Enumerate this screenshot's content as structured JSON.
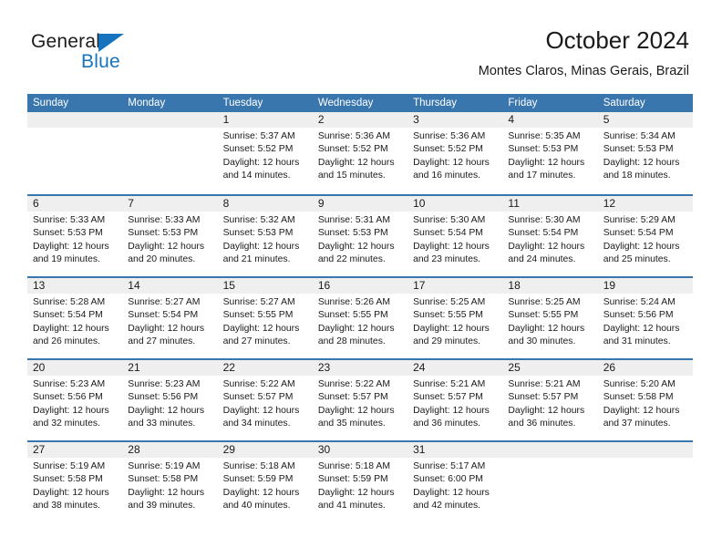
{
  "brand": {
    "name_top": "General",
    "name_bottom": "Blue",
    "accent_color": "#1574bd",
    "triangle_icon": "brand-triangle-icon"
  },
  "header": {
    "title": "October 2024",
    "subtitle": "Montes Claros, Minas Gerais, Brazil"
  },
  "theme": {
    "header_blue": "#3a76ae",
    "daynum_band": "#efefef",
    "text": "#1a1a1a"
  },
  "calendar": {
    "weekday_headers": [
      "Sunday",
      "Monday",
      "Tuesday",
      "Wednesday",
      "Thursday",
      "Friday",
      "Saturday"
    ],
    "weeks": [
      [
        {
          "day": "",
          "lines": []
        },
        {
          "day": "",
          "lines": []
        },
        {
          "day": "1",
          "lines": [
            "Sunrise: 5:37 AM",
            "Sunset: 5:52 PM",
            "Daylight: 12 hours and 14 minutes."
          ]
        },
        {
          "day": "2",
          "lines": [
            "Sunrise: 5:36 AM",
            "Sunset: 5:52 PM",
            "Daylight: 12 hours and 15 minutes."
          ]
        },
        {
          "day": "3",
          "lines": [
            "Sunrise: 5:36 AM",
            "Sunset: 5:52 PM",
            "Daylight: 12 hours and 16 minutes."
          ]
        },
        {
          "day": "4",
          "lines": [
            "Sunrise: 5:35 AM",
            "Sunset: 5:53 PM",
            "Daylight: 12 hours and 17 minutes."
          ]
        },
        {
          "day": "5",
          "lines": [
            "Sunrise: 5:34 AM",
            "Sunset: 5:53 PM",
            "Daylight: 12 hours and 18 minutes."
          ]
        }
      ],
      [
        {
          "day": "6",
          "lines": [
            "Sunrise: 5:33 AM",
            "Sunset: 5:53 PM",
            "Daylight: 12 hours and 19 minutes."
          ]
        },
        {
          "day": "7",
          "lines": [
            "Sunrise: 5:33 AM",
            "Sunset: 5:53 PM",
            "Daylight: 12 hours and 20 minutes."
          ]
        },
        {
          "day": "8",
          "lines": [
            "Sunrise: 5:32 AM",
            "Sunset: 5:53 PM",
            "Daylight: 12 hours and 21 minutes."
          ]
        },
        {
          "day": "9",
          "lines": [
            "Sunrise: 5:31 AM",
            "Sunset: 5:53 PM",
            "Daylight: 12 hours and 22 minutes."
          ]
        },
        {
          "day": "10",
          "lines": [
            "Sunrise: 5:30 AM",
            "Sunset: 5:54 PM",
            "Daylight: 12 hours and 23 minutes."
          ]
        },
        {
          "day": "11",
          "lines": [
            "Sunrise: 5:30 AM",
            "Sunset: 5:54 PM",
            "Daylight: 12 hours and 24 minutes."
          ]
        },
        {
          "day": "12",
          "lines": [
            "Sunrise: 5:29 AM",
            "Sunset: 5:54 PM",
            "Daylight: 12 hours and 25 minutes."
          ]
        }
      ],
      [
        {
          "day": "13",
          "lines": [
            "Sunrise: 5:28 AM",
            "Sunset: 5:54 PM",
            "Daylight: 12 hours and 26 minutes."
          ]
        },
        {
          "day": "14",
          "lines": [
            "Sunrise: 5:27 AM",
            "Sunset: 5:54 PM",
            "Daylight: 12 hours and 27 minutes."
          ]
        },
        {
          "day": "15",
          "lines": [
            "Sunrise: 5:27 AM",
            "Sunset: 5:55 PM",
            "Daylight: 12 hours and 27 minutes."
          ]
        },
        {
          "day": "16",
          "lines": [
            "Sunrise: 5:26 AM",
            "Sunset: 5:55 PM",
            "Daylight: 12 hours and 28 minutes."
          ]
        },
        {
          "day": "17",
          "lines": [
            "Sunrise: 5:25 AM",
            "Sunset: 5:55 PM",
            "Daylight: 12 hours and 29 minutes."
          ]
        },
        {
          "day": "18",
          "lines": [
            "Sunrise: 5:25 AM",
            "Sunset: 5:55 PM",
            "Daylight: 12 hours and 30 minutes."
          ]
        },
        {
          "day": "19",
          "lines": [
            "Sunrise: 5:24 AM",
            "Sunset: 5:56 PM",
            "Daylight: 12 hours and 31 minutes."
          ]
        }
      ],
      [
        {
          "day": "20",
          "lines": [
            "Sunrise: 5:23 AM",
            "Sunset: 5:56 PM",
            "Daylight: 12 hours and 32 minutes."
          ]
        },
        {
          "day": "21",
          "lines": [
            "Sunrise: 5:23 AM",
            "Sunset: 5:56 PM",
            "Daylight: 12 hours and 33 minutes."
          ]
        },
        {
          "day": "22",
          "lines": [
            "Sunrise: 5:22 AM",
            "Sunset: 5:57 PM",
            "Daylight: 12 hours and 34 minutes."
          ]
        },
        {
          "day": "23",
          "lines": [
            "Sunrise: 5:22 AM",
            "Sunset: 5:57 PM",
            "Daylight: 12 hours and 35 minutes."
          ]
        },
        {
          "day": "24",
          "lines": [
            "Sunrise: 5:21 AM",
            "Sunset: 5:57 PM",
            "Daylight: 12 hours and 36 minutes."
          ]
        },
        {
          "day": "25",
          "lines": [
            "Sunrise: 5:21 AM",
            "Sunset: 5:57 PM",
            "Daylight: 12 hours and 36 minutes."
          ]
        },
        {
          "day": "26",
          "lines": [
            "Sunrise: 5:20 AM",
            "Sunset: 5:58 PM",
            "Daylight: 12 hours and 37 minutes."
          ]
        }
      ],
      [
        {
          "day": "27",
          "lines": [
            "Sunrise: 5:19 AM",
            "Sunset: 5:58 PM",
            "Daylight: 12 hours and 38 minutes."
          ]
        },
        {
          "day": "28",
          "lines": [
            "Sunrise: 5:19 AM",
            "Sunset: 5:58 PM",
            "Daylight: 12 hours and 39 minutes."
          ]
        },
        {
          "day": "29",
          "lines": [
            "Sunrise: 5:18 AM",
            "Sunset: 5:59 PM",
            "Daylight: 12 hours and 40 minutes."
          ]
        },
        {
          "day": "30",
          "lines": [
            "Sunrise: 5:18 AM",
            "Sunset: 5:59 PM",
            "Daylight: 12 hours and 41 minutes."
          ]
        },
        {
          "day": "31",
          "lines": [
            "Sunrise: 5:17 AM",
            "Sunset: 6:00 PM",
            "Daylight: 12 hours and 42 minutes."
          ]
        },
        {
          "day": "",
          "lines": []
        },
        {
          "day": "",
          "lines": []
        }
      ]
    ]
  }
}
